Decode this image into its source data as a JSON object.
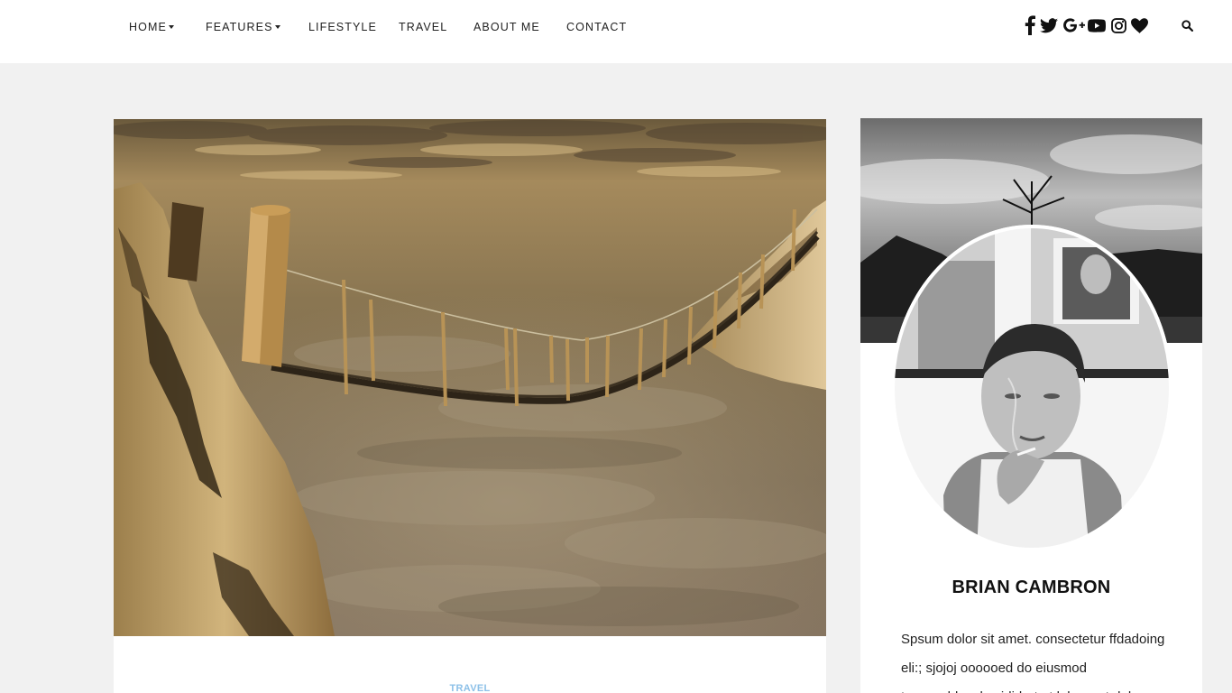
{
  "nav": {
    "items": [
      {
        "label": "HOME",
        "dropdown": true
      },
      {
        "label": "FEATURES",
        "dropdown": true
      },
      {
        "label": "LIFESTYLE",
        "dropdown": false
      },
      {
        "label": "TRAVEL",
        "dropdown": false
      },
      {
        "label": "ABOUT ME",
        "dropdown": false
      },
      {
        "label": "CONTACT",
        "dropdown": false
      }
    ]
  },
  "social": {
    "icons": [
      "facebook-icon",
      "twitter-icon",
      "google-plus-icon",
      "youtube-icon",
      "instagram-icon",
      "heart-icon"
    ],
    "search_icon": "search-icon"
  },
  "post": {
    "image_subject": "wooden rope bridge above clouds",
    "category": "TRAVEL"
  },
  "sidebar": {
    "author_name": "BRIAN CAMBRON",
    "bio": "Spsum dolor sit amet. consectetur ffdadoing eli:; sjojoj oooooed do eiusmod temporddwud ncididurt ut labore et dolore"
  },
  "colors": {
    "background": "#f1f1f1",
    "card": "#ffffff",
    "category_accent": "#8cc0e8",
    "text": "#222222"
  }
}
